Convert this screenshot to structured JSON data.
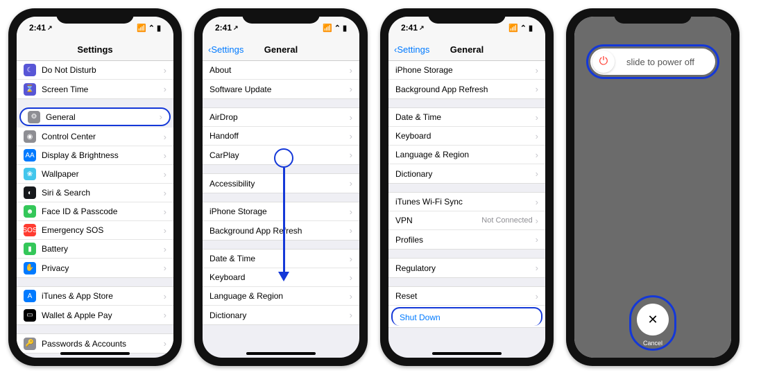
{
  "statusbar": {
    "time": "2:41",
    "loc": "➤"
  },
  "phone1": {
    "title": "Settings",
    "items": [
      {
        "icon": "#5856d6",
        "glyph": "☾",
        "label": "Do Not Disturb"
      },
      {
        "icon": "#5856d6",
        "glyph": "⌛",
        "label": "Screen Time"
      }
    ],
    "general": {
      "icon": "#8e8e93",
      "glyph": "⚙",
      "label": "General"
    },
    "items2": [
      {
        "icon": "#8e8e93",
        "glyph": "◉",
        "label": "Control Center"
      },
      {
        "icon": "#007aff",
        "glyph": "AA",
        "label": "Display & Brightness"
      },
      {
        "icon": "#42c6ec",
        "glyph": "❀",
        "label": "Wallpaper"
      },
      {
        "icon": "#17191c",
        "glyph": "◐",
        "label": "Siri & Search"
      },
      {
        "icon": "#34c759",
        "glyph": "☻",
        "label": "Face ID & Passcode"
      },
      {
        "icon": "#ff3b30",
        "glyph": "SOS",
        "label": "Emergency SOS"
      },
      {
        "icon": "#34c759",
        "glyph": "▮",
        "label": "Battery"
      },
      {
        "icon": "#007aff",
        "glyph": "✋",
        "label": "Privacy"
      }
    ],
    "items3": [
      {
        "icon": "#007aff",
        "glyph": "A",
        "label": "iTunes & App Store"
      },
      {
        "icon": "#000",
        "glyph": "▭",
        "label": "Wallet & Apple Pay"
      }
    ],
    "items4": [
      {
        "icon": "#8e8e93",
        "glyph": "🔑",
        "label": "Passwords & Accounts"
      }
    ]
  },
  "phone2": {
    "back": "Settings",
    "title": "General",
    "g1": [
      "About",
      "Software Update"
    ],
    "g2": [
      "AirDrop",
      "Handoff",
      "CarPlay"
    ],
    "g3": [
      "Accessibility"
    ],
    "g4": [
      "iPhone Storage",
      "Background App Refresh"
    ],
    "g5": [
      "Date & Time",
      "Keyboard",
      "Language & Region",
      "Dictionary"
    ]
  },
  "phone3": {
    "back": "Settings",
    "title": "General",
    "g1": [
      "iPhone Storage",
      "Background App Refresh"
    ],
    "g2": [
      "Date & Time",
      "Keyboard",
      "Language & Region",
      "Dictionary"
    ],
    "g3": [
      {
        "label": "iTunes Wi-Fi Sync"
      },
      {
        "label": "VPN",
        "detail": "Not Connected"
      },
      {
        "label": "Profiles"
      }
    ],
    "g4": [
      "Regulatory"
    ],
    "g5": [
      "Reset"
    ],
    "shutdown": "Shut Down"
  },
  "phone4": {
    "slide": "slide to power off",
    "cancel": "Cancel"
  }
}
